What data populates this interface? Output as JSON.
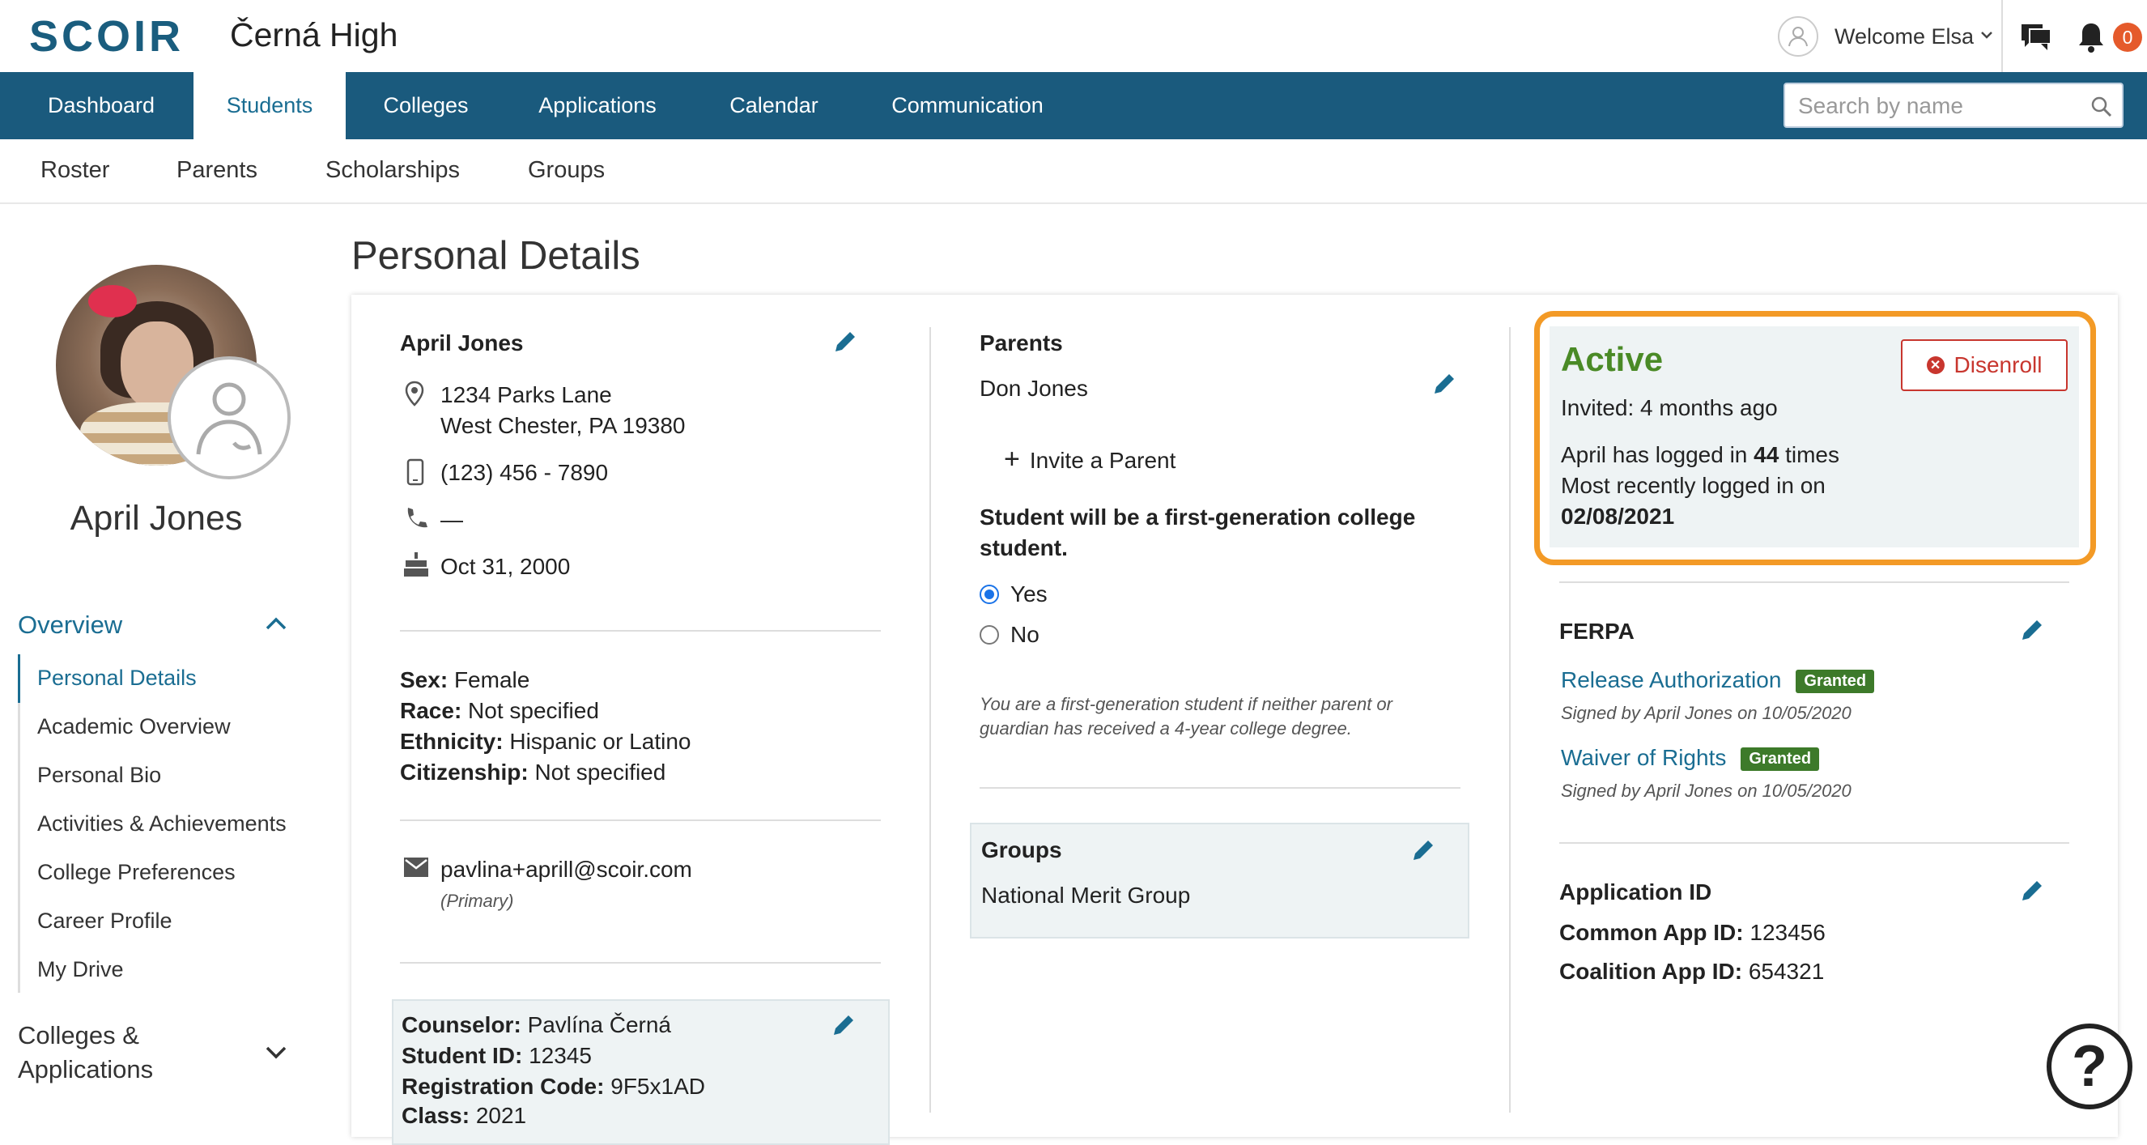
{
  "app": {
    "logo": "SCOIR",
    "school": "Černá High",
    "welcome": "Welcome Elsa",
    "notification_count": "0"
  },
  "colors": {
    "nav_bg": "#1a5a7d",
    "accent": "#1a6d92",
    "active_green": "#4a8a26",
    "highlight_outline": "#f39a26",
    "danger": "#c8362e",
    "badge_green": "#3d7a2a"
  },
  "nav": {
    "tabs": [
      {
        "label": "Dashboard",
        "active": false
      },
      {
        "label": "Students",
        "active": true
      },
      {
        "label": "Colleges",
        "active": false
      },
      {
        "label": "Applications",
        "active": false
      },
      {
        "label": "Calendar",
        "active": false
      },
      {
        "label": "Communication",
        "active": false
      }
    ],
    "search_placeholder": "Search by name"
  },
  "subnav": {
    "tabs": [
      "Roster",
      "Parents",
      "Scholarships",
      "Groups"
    ]
  },
  "sidebar": {
    "student_name": "April Jones",
    "overview_label": "Overview",
    "items": [
      {
        "label": "Personal Details",
        "active": true
      },
      {
        "label": "Academic Overview",
        "active": false
      },
      {
        "label": "Personal Bio",
        "active": false
      },
      {
        "label": "Activities & Achievements",
        "active": false
      },
      {
        "label": "College Preferences",
        "active": false
      },
      {
        "label": "Career Profile",
        "active": false
      },
      {
        "label": "My Drive",
        "active": false
      }
    ],
    "colleges_label_line1": "Colleges &",
    "colleges_label_line2": "Applications"
  },
  "main": {
    "page_title": "Personal Details",
    "contact": {
      "name": "April Jones",
      "address_line1": "1234 Parks Lane",
      "address_line2": "West Chester, PA 19380",
      "mobile": "(123) 456 - 7890",
      "phone": "—",
      "birthday": "Oct 31, 2000",
      "sex_label": "Sex:",
      "sex": "Female",
      "race_label": "Race:",
      "race": "Not specified",
      "ethnicity_label": "Ethnicity:",
      "ethnicity": "Hispanic or Latino",
      "citizenship_label": "Citizenship:",
      "citizenship": "Not specified",
      "email": "pavlina+aprill@scoir.com",
      "email_type": "(Primary)",
      "counselor_label": "Counselor:",
      "counselor": "Pavlína Černá",
      "student_id_label": "Student ID:",
      "student_id": "12345",
      "registration_label": "Registration Code:",
      "registration_code": "9F5x1AD",
      "class_label": "Class:",
      "class_year": "2021"
    },
    "parents": {
      "heading": "Parents",
      "parent_name": "Don Jones",
      "invite_label": "Invite a Parent",
      "first_gen_question": "Student will be a first-generation college student.",
      "option_yes": "Yes",
      "option_no": "No",
      "selected": "Yes",
      "note_line1": "You are a first-generation student if neither parent or",
      "note_line2": "guardian has received a 4-year college degree."
    },
    "groups": {
      "heading": "Groups",
      "group_name": "National Merit Group"
    },
    "status": {
      "label": "Active",
      "disenroll_label": "Disenroll",
      "invited": "Invited: 4 months ago",
      "logins_prefix": "April has logged in ",
      "logins_count": "44",
      "logins_suffix": " times",
      "recent_label": "Most recently logged in on",
      "recent_date": "02/08/2021"
    },
    "ferpa": {
      "heading": "FERPA",
      "items": [
        {
          "label": "Release Authorization",
          "badge": "Granted",
          "signed": "Signed by April Jones on 10/05/2020"
        },
        {
          "label": "Waiver of Rights",
          "badge": "Granted",
          "signed": "Signed by April Jones on 10/05/2020"
        }
      ]
    },
    "application_id": {
      "heading": "Application ID",
      "common_label": "Common App ID:",
      "common_value": "123456",
      "coalition_label": "Coalition App ID:",
      "coalition_value": "654321"
    }
  },
  "help_icon": "question-icon"
}
